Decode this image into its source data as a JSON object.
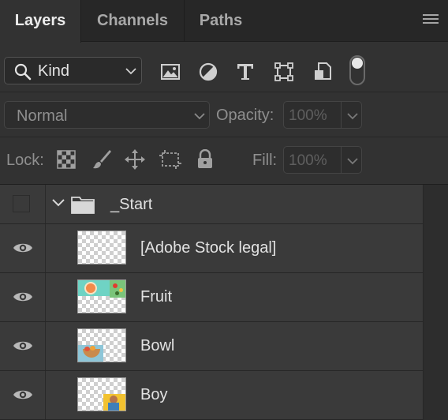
{
  "tabs": [
    {
      "label": "Layers",
      "active": true
    },
    {
      "label": "Channels",
      "active": false
    },
    {
      "label": "Paths",
      "active": false
    }
  ],
  "filter": {
    "kind_label": "Kind",
    "filter_icons": [
      "image-filter-icon",
      "adjustment-filter-icon",
      "type-filter-icon",
      "shape-filter-icon",
      "smart-object-filter-icon"
    ],
    "filter_toggle": "on"
  },
  "blend": {
    "mode": "Normal",
    "opacity_label": "Opacity:",
    "opacity_value": "100%"
  },
  "lock": {
    "label": "Lock:",
    "icons": [
      "lock-transparent-pixels-icon",
      "lock-image-pixels-icon",
      "lock-position-icon",
      "lock-artboard-icon",
      "lock-all-icon"
    ],
    "fill_label": "Fill:",
    "fill_value": "100%"
  },
  "layers": {
    "group": {
      "name": "_Start",
      "expanded": true
    },
    "items": [
      {
        "name": "[Adobe Stock legal]",
        "thumbnail": "transparent"
      },
      {
        "name": "Fruit",
        "thumbnail": "fruit"
      },
      {
        "name": "Bowl",
        "thumbnail": "bowl"
      },
      {
        "name": "Boy",
        "thumbnail": "boy"
      }
    ]
  },
  "colors": {
    "panel_bg": "#323232",
    "tab_bar_bg": "#272727",
    "layer_row_bg": "#3a3a3a",
    "text": "#e2e2e2",
    "dim_text": "#8f8f8f"
  }
}
